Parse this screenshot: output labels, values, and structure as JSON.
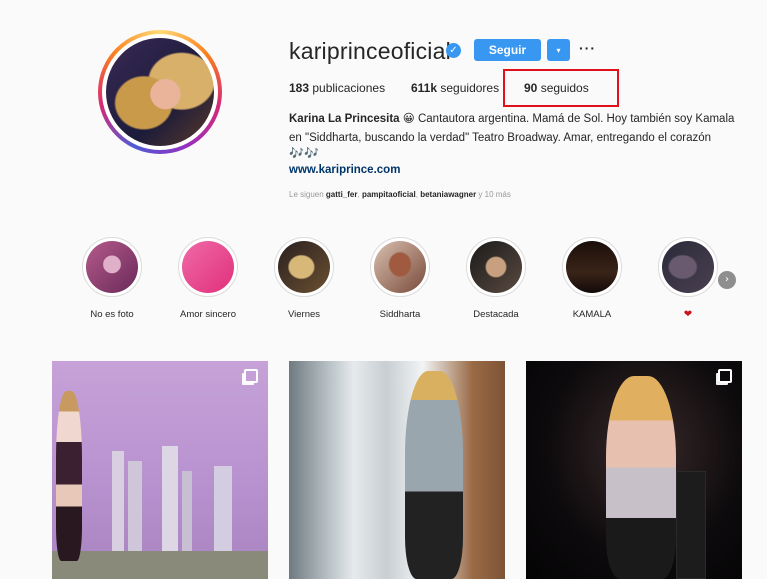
{
  "profile": {
    "username": "kariprinceoficial",
    "verified_icon": "verified-badge-icon",
    "follow_label": "Seguir",
    "dropdown_icon": "▾",
    "more_icon": "···",
    "stats": {
      "posts_count": "183",
      "posts_label": " publicaciones",
      "followers_count": "611k",
      "followers_label": " seguidores",
      "following_count": "90",
      "following_label": " seguidos"
    },
    "bio": {
      "name": "Karina La Princesita",
      "emoji": "😀",
      "text": " Cantautora argentina. Mamá de Sol. Hoy también soy Kamala en \"Siddharta, buscando la verdad\" Teatro Broadway. Amar, entregando el corazón",
      "notes": "🎶🎶",
      "website": "www.kariprince.com"
    },
    "followed_by": {
      "prefix": "Le siguen ",
      "user1": "gatti_fer",
      "user2": "pampitaoficial",
      "user3": "betaniawagner",
      "suffix": " y 10 más"
    }
  },
  "highlights": [
    {
      "label": "No es foto"
    },
    {
      "label": "Amor sincero"
    },
    {
      "label": "Viernes"
    },
    {
      "label": "Siddharta"
    },
    {
      "label": "Destacada"
    },
    {
      "label": "KAMALA"
    },
    {
      "label": "❤"
    }
  ],
  "highlight_next_icon": "›",
  "colors": {
    "accent": "#3897f0",
    "annotation_box": "#e0101c",
    "link": "#003569"
  }
}
